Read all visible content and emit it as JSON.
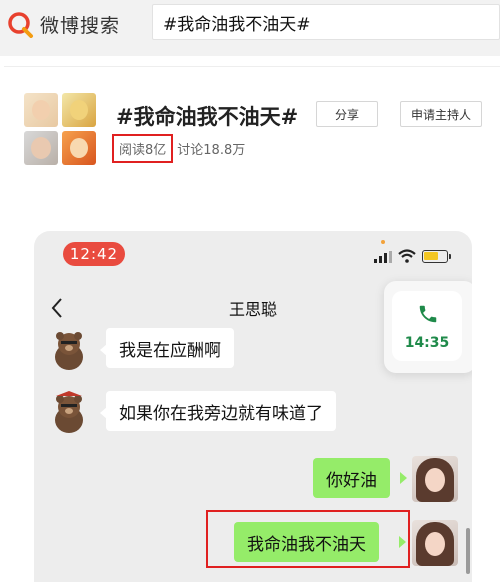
{
  "header": {
    "logo_text": "微博搜索",
    "search_value": "#我命油我不油天#"
  },
  "topic": {
    "title": "#我命油我不油天#",
    "share_label": "分享",
    "host_label": "申请主持人",
    "reads": "阅读8亿",
    "discussions": "讨论18.8万"
  },
  "phone": {
    "status_time": "12:42",
    "contact_name": "王思聪",
    "call_time": "14:35",
    "messages": [
      {
        "side": "left",
        "text": "我是在应酬啊"
      },
      {
        "side": "left",
        "text": "如果你在我旁边就有味道了"
      },
      {
        "side": "right",
        "text": "你好油"
      },
      {
        "side": "right",
        "text": "我命油我不油天"
      }
    ]
  },
  "colors": {
    "highlight": "#e02020",
    "bubble_green": "#95ec69",
    "call_green": "#1f8a4a",
    "time_pill": "#e94b3f"
  }
}
